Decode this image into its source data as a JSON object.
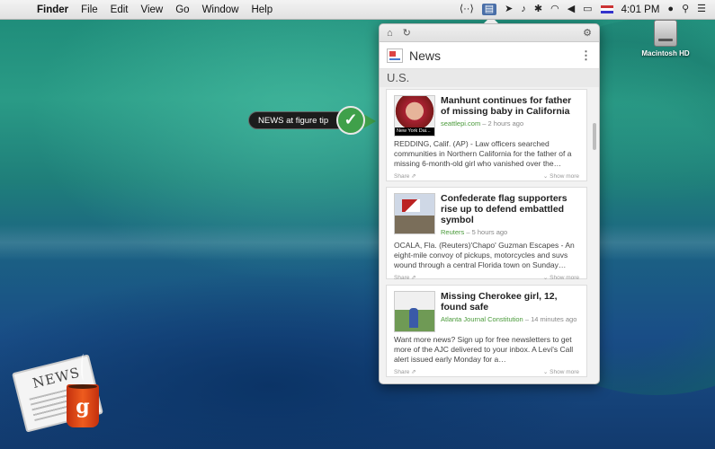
{
  "menubar": {
    "apple_icon": "",
    "items": [
      "Finder",
      "File",
      "Edit",
      "View",
      "Go",
      "Window",
      "Help"
    ],
    "status_icons": [
      {
        "name": "code-icon",
        "glyph": "⟨··⟩"
      },
      {
        "name": "news-menu-icon",
        "glyph": "▤"
      },
      {
        "name": "flag-arrow-icon",
        "glyph": "➤"
      },
      {
        "name": "bell-icon",
        "glyph": "♪"
      },
      {
        "name": "bluetooth-icon",
        "glyph": "✱"
      },
      {
        "name": "wifi-icon",
        "glyph": "◠"
      },
      {
        "name": "volume-icon",
        "glyph": "◀"
      },
      {
        "name": "battery-icon",
        "glyph": "▭"
      }
    ],
    "clock": "4:01 PM",
    "user_icon": "●",
    "spotlight_icon": "⚲",
    "notification_icon": "☰"
  },
  "desktop": {
    "drive_label": "Macintosh HD"
  },
  "tip": {
    "label": "NEWS at figure tip",
    "check_glyph": "✓"
  },
  "panel": {
    "home_icon": "⌂",
    "refresh_icon": "↻",
    "settings_icon": "⚙",
    "title": "News",
    "menu_icon": "⋮",
    "section": "U.S.",
    "articles": [
      {
        "headline": "Manhunt continues for father of missing baby in California",
        "source": "seattlepi.com",
        "time": "– 2 hours ago",
        "thumb_caption": "New York Dai...",
        "snippet": "REDDING, Calif. (AP) - Law officers searched communities in Northern California for the father of a missing 6-month-old girl who vanished over the…",
        "share": "Share",
        "show_more": "Show more"
      },
      {
        "headline": "Confederate flag supporters rise up to defend embattled symbol",
        "source": "Reuters",
        "time": "– 5 hours ago",
        "thumb_caption": "",
        "snippet": "OCALA, Fla. (Reuters)'Chapo' Guzman Escapes - An eight-mile convoy of pickups, motorcycles and suvs wound through a central Florida town on Sunday…",
        "share": "Share",
        "show_more": "Show more"
      },
      {
        "headline": "Missing Cherokee girl, 12, found safe",
        "source": "Atlanta Journal Constitution",
        "time": "– 14 minutes ago",
        "thumb_caption": "",
        "snippet": "Want more news? Sign up for free newsletters to get more of the AJC delivered to your inbox. A Levi's Call alert issued early Monday for a…",
        "share": "Share",
        "show_more": "Show more"
      }
    ]
  },
  "app_icon": {
    "paper_text": "NEWS",
    "mug_letter": "g"
  }
}
